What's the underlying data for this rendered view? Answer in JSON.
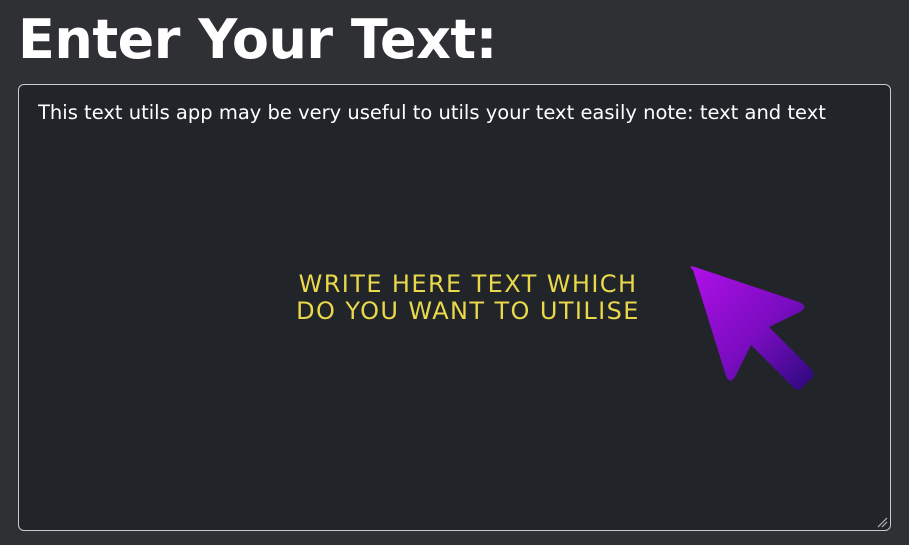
{
  "heading": "Enter Your Text:",
  "textarea": {
    "value": "This text utils app may be very useful to utils your text easily note: text and text"
  },
  "hint": {
    "line1": "Write here text which",
    "line2": "do you want to utilise",
    "color": "#e8d84a"
  },
  "icons": {
    "pointer": "arrow-pointer-icon",
    "resize": "resize-grip-icon"
  },
  "colors": {
    "background": "#2f3034",
    "textarea_background": "#212428",
    "textarea_border": "#c8cace",
    "arrow_gradient_start": "#b010e8",
    "arrow_gradient_end": "#2a0a7a"
  }
}
